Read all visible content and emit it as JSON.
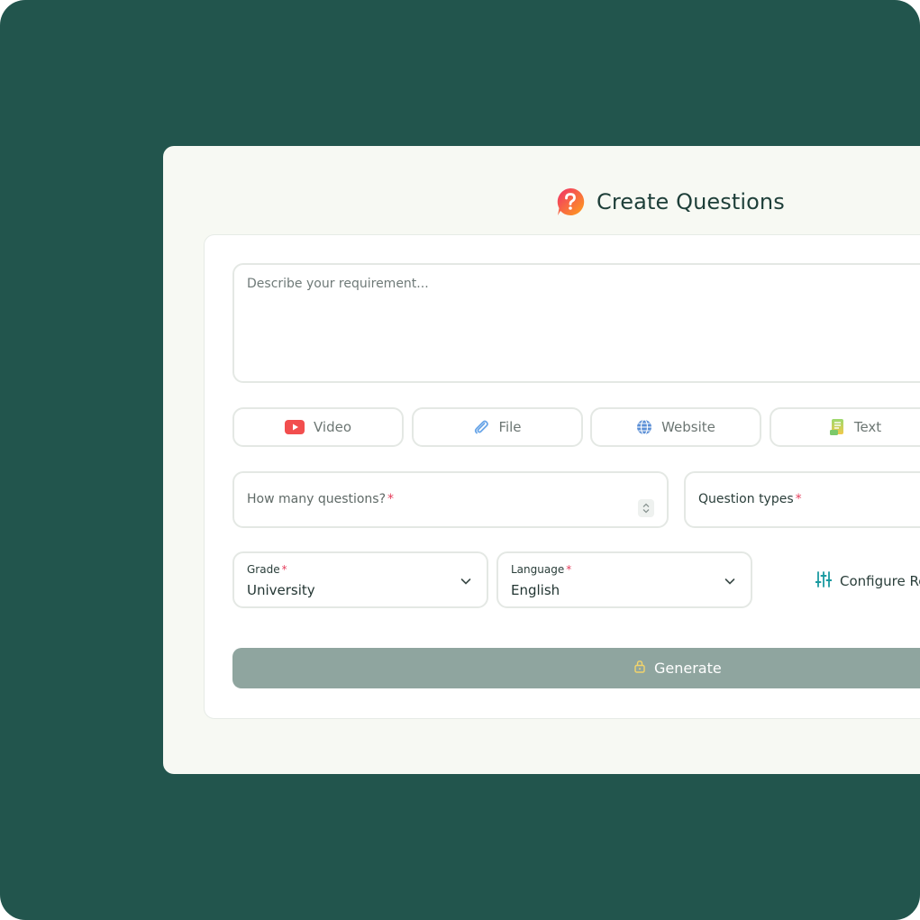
{
  "header": {
    "title": "Create Questions",
    "icon": "question-bubble-icon"
  },
  "requirement": {
    "placeholder": "Describe your requirement...",
    "value": ""
  },
  "sources": [
    {
      "label": "Video",
      "icon": "youtube-icon",
      "color": "#f24e4e"
    },
    {
      "label": "File",
      "icon": "paperclip-icon",
      "color": "#6aa6e8"
    },
    {
      "label": "Website",
      "icon": "globe-icon",
      "color": "#5b8fd6"
    },
    {
      "label": "Text",
      "icon": "document-text-icon",
      "color": "#7cc96a"
    }
  ],
  "fields": {
    "question_count": {
      "label": "How many questions?",
      "required_mark": "*"
    },
    "question_types": {
      "label": "Question types",
      "required_mark": "*"
    },
    "grade": {
      "label": "Grade",
      "required_mark": "*",
      "value": "University"
    },
    "language": {
      "label": "Language",
      "required_mark": "*",
      "value": "English"
    }
  },
  "configure": {
    "label": "Configure Re",
    "icon": "sliders-icon"
  },
  "generate": {
    "label": "Generate",
    "icon": "lock-icon"
  },
  "colors": {
    "background": "#22554d",
    "window": "#f7f9f3",
    "generate_button": "#8fa59f",
    "required": "#e53e5c",
    "accent_teal": "#1a9aa0"
  }
}
